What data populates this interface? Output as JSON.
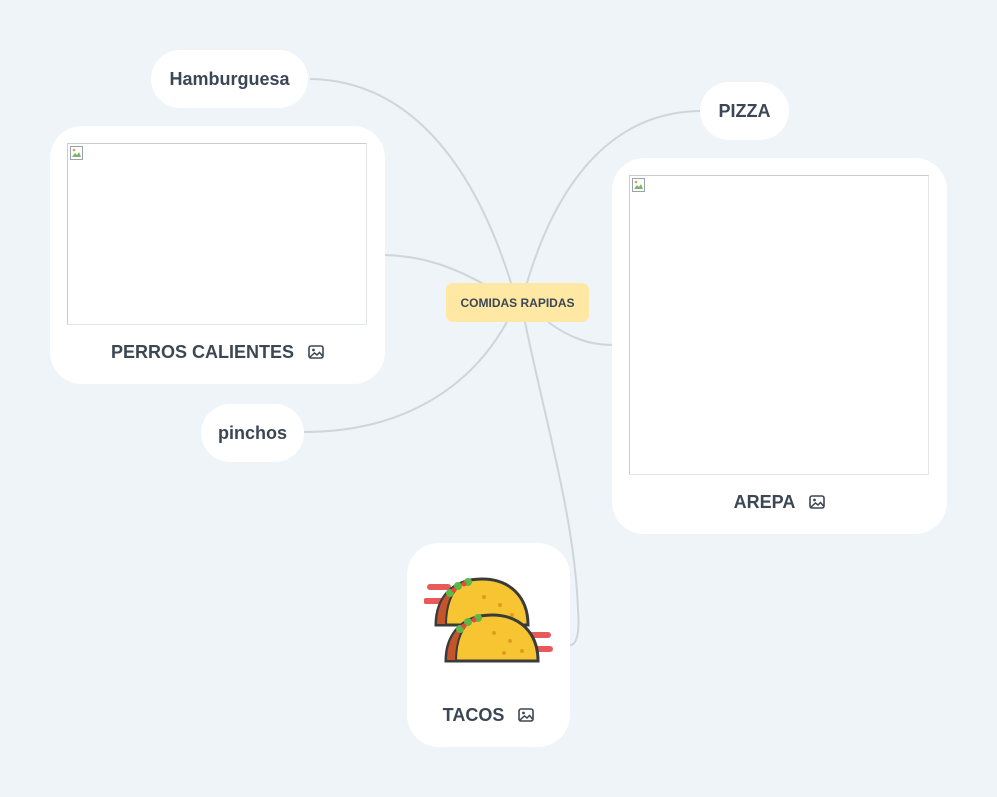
{
  "central": {
    "label": "COMIDAS RAPIDAS"
  },
  "nodes": {
    "hamburguesa": {
      "label": "Hamburguesa"
    },
    "pizza": {
      "label": "PIZZA"
    },
    "pinchos": {
      "label": "pinchos"
    },
    "perros": {
      "label": "PERROS CALIENTES",
      "icon": "image-icon"
    },
    "arepa": {
      "label": "AREPA",
      "icon": "image-icon"
    },
    "tacos": {
      "label": "TACOS",
      "icon": "image-icon"
    }
  },
  "colors": {
    "background": "#eef4f7",
    "central_fill": "#ffe8a3",
    "link": "#c9d1d6",
    "text": "#3b4754"
  }
}
